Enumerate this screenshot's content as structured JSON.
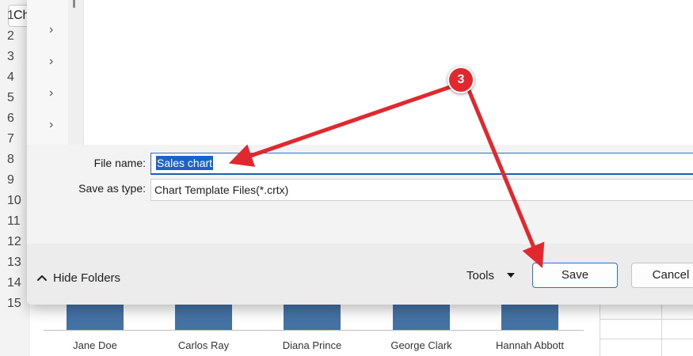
{
  "excel": {
    "name_box": "Ch",
    "row_numbers": [
      "1",
      "2",
      "3",
      "4",
      "5",
      "6",
      "7",
      "8",
      "9",
      "10",
      "11",
      "12",
      "13",
      "14",
      "15"
    ],
    "chart": {
      "categories": [
        "Jane Doe",
        "Carlos Ray",
        "Diana Prince",
        "George Clark",
        "Hannah Abbott"
      ],
      "bar_color": "#4472a4"
    }
  },
  "dialog": {
    "file_name_label": "File name:",
    "file_name_value": "Sales chart",
    "save_as_type_label": "Save as type:",
    "save_as_type_value": "Chart Template Files(*.crtx)",
    "hide_folders_label": "Hide Folders",
    "tools_label": "Tools",
    "save_label": "Save",
    "cancel_label": "Cancel"
  },
  "annotation": {
    "step_number": "3",
    "color": "#e0282e"
  }
}
